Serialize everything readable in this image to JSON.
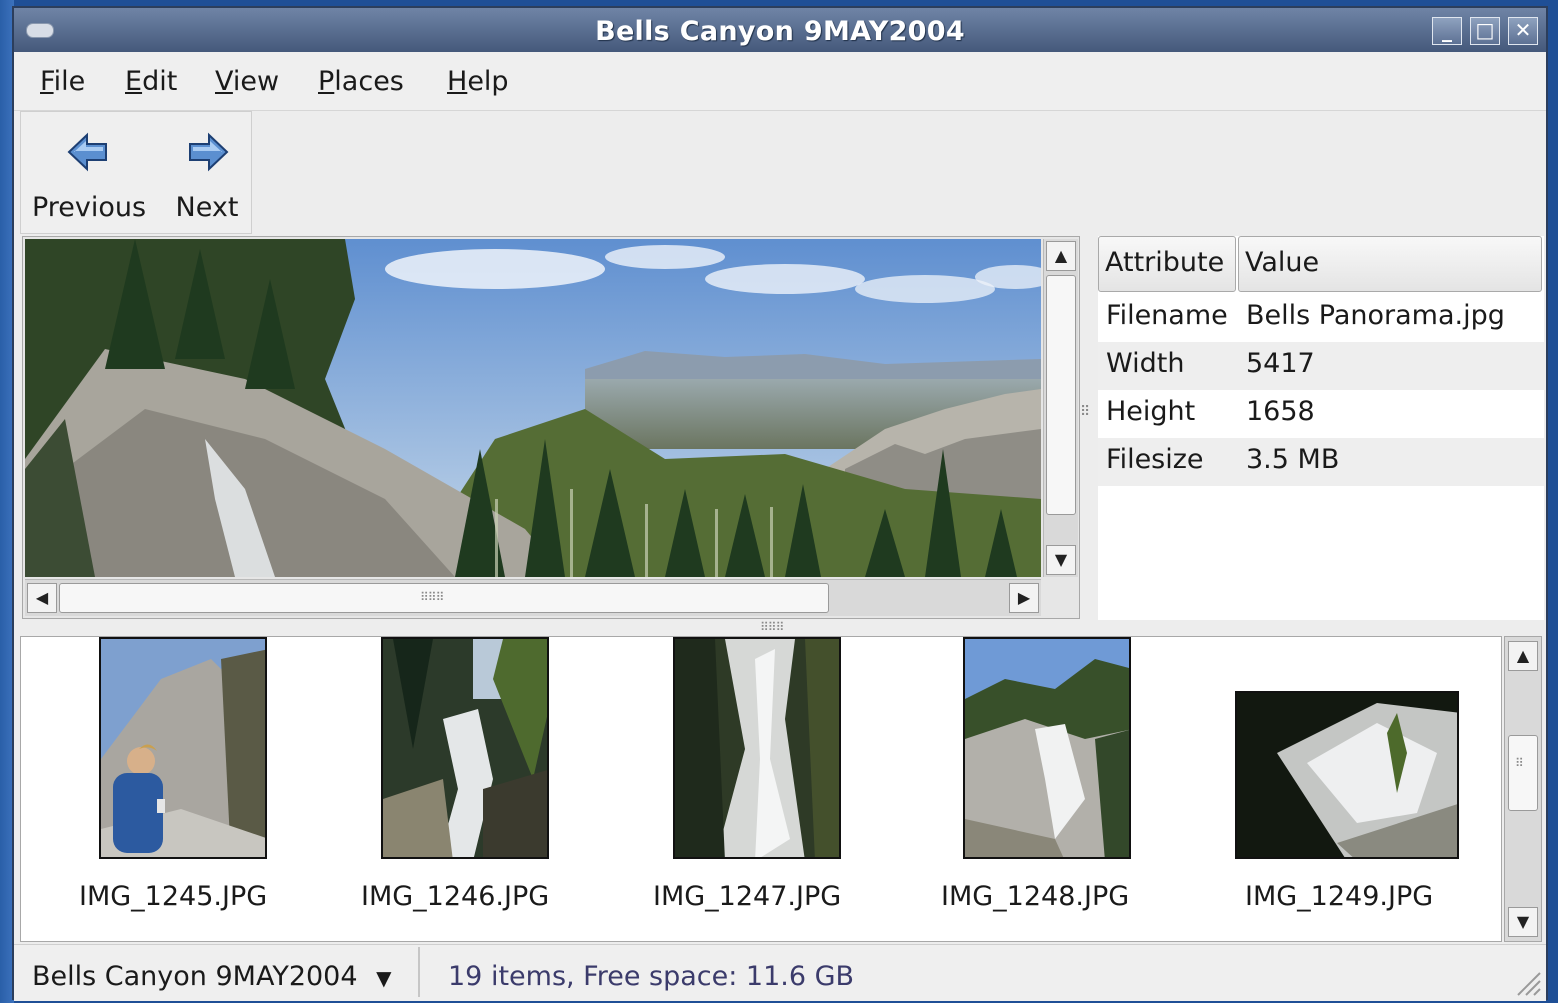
{
  "window": {
    "title": "Bells Canyon 9MAY2004",
    "buttons": {
      "minimize": "_",
      "maximize": "□",
      "close": "✕"
    }
  },
  "menu": [
    {
      "label": "File",
      "mnemonic": "F",
      "rest": "ile"
    },
    {
      "label": "Edit",
      "mnemonic": "E",
      "rest": "dit"
    },
    {
      "label": "View",
      "mnemonic": "V",
      "rest": "iew"
    },
    {
      "label": "Places",
      "mnemonic": "P",
      "rest": "laces"
    },
    {
      "label": "Help",
      "mnemonic": "H",
      "rest": "elp"
    }
  ],
  "toolbar": {
    "previous_label": "Previous",
    "next_label": "Next",
    "previous_icon": "arrow-left-icon",
    "next_icon": "arrow-right-icon"
  },
  "properties": {
    "columns": [
      "Attribute",
      "Value"
    ],
    "rows": [
      {
        "attribute": "Filename",
        "value": "Bells Panorama.jpg"
      },
      {
        "attribute": "Width",
        "value": "5417"
      },
      {
        "attribute": "Height",
        "value": "1658"
      },
      {
        "attribute": "Filesize",
        "value": "3.5 MB"
      }
    ]
  },
  "thumbnails": [
    {
      "label": "IMG_1245.JPG"
    },
    {
      "label": "IMG_1246.JPG"
    },
    {
      "label": "IMG_1247.JPG"
    },
    {
      "label": "IMG_1248.JPG"
    },
    {
      "label": "IMG_1249.JPG"
    }
  ],
  "status": {
    "folder": "Bells Canyon 9MAY2004",
    "text": "19 items, Free space: 11.6 GB"
  },
  "colors": {
    "titlebar": "#5a6e90",
    "desktop": "#1f4f96",
    "status_text": "#3b3b6b"
  }
}
